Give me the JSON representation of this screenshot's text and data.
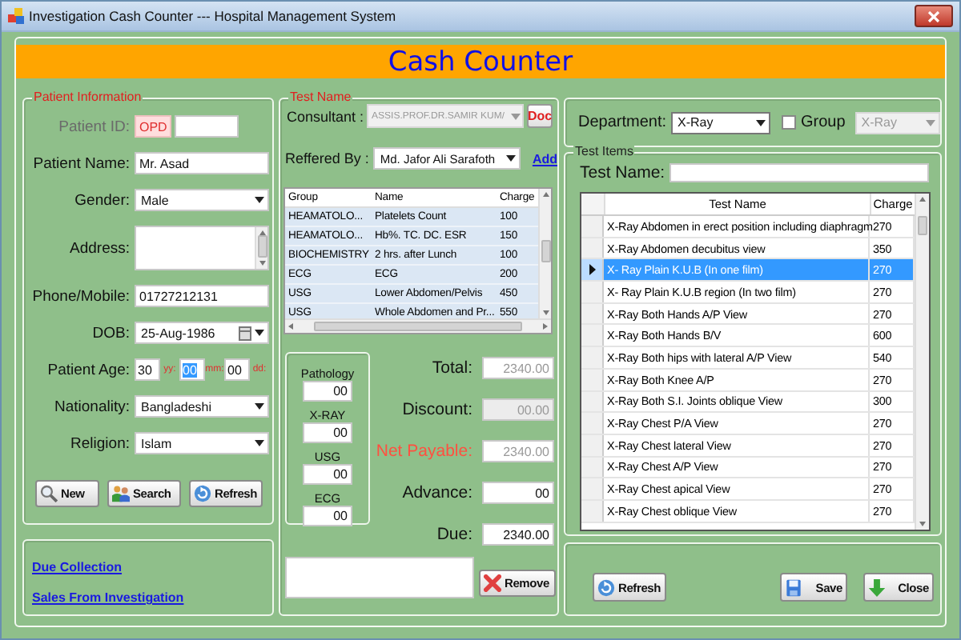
{
  "window": {
    "title": "Investigation Cash Counter --- Hospital Management System"
  },
  "header": {
    "title": "Cash Counter"
  },
  "patient_info": {
    "legend": "Patient Information",
    "fields": [
      {
        "kind": "id",
        "label": "Patient ID:",
        "prefix": "OPD",
        "disabled": true
      },
      {
        "kind": "text",
        "label": "Patient Name:",
        "value": "Mr. Asad",
        "disabled": false
      },
      {
        "kind": "select",
        "label": "Gender:",
        "value": "Male",
        "disabled": false
      },
      {
        "kind": "textarea",
        "label": "Address:",
        "disabled": false
      },
      {
        "kind": "text",
        "label": "Phone/Mobile:",
        "value": "01727212131",
        "disabled": false
      },
      {
        "kind": "date",
        "label": "DOB:",
        "value": "25-Aug-1986",
        "disabled": false
      },
      {
        "kind": "age",
        "label": "Patient Age:",
        "disabled": false,
        "parts": [
          {
            "value": "30",
            "unit": "yy:",
            "selected": false
          },
          {
            "value": "00",
            "unit": "mm:",
            "selected": true
          },
          {
            "value": "00",
            "unit": "dd:",
            "selected": false
          }
        ]
      },
      {
        "kind": "select",
        "label": "Nationality:",
        "value": "Bangladeshi",
        "disabled": false
      },
      {
        "kind": "select",
        "label": "Religion:",
        "value": "Islam",
        "disabled": false
      }
    ],
    "buttons": [
      "New",
      "Search",
      "Refresh"
    ]
  },
  "links": [
    "Due Collection",
    "Sales From Investigation"
  ],
  "test_name": {
    "legend": "Test Name",
    "consultant": {
      "label": "Consultant :",
      "value": "ASSIS.PROF.DR.SAMIR KUM/",
      "disabled": true
    },
    "doc_button": "Doc",
    "referred_by": {
      "label": "Reffered By :",
      "value": "Md. Jafor Ali Sarafoth"
    },
    "add_link": "Add",
    "table": {
      "columns": [
        "Group",
        "Name",
        "Charge"
      ],
      "rows": [
        [
          "HEAMATOLO...",
          "Platelets Count",
          "100"
        ],
        [
          "HEAMATOLO...",
          "Hb%. TC. DC. ESR",
          "150"
        ],
        [
          "BIOCHEMISTRY",
          "2 hrs. after Lunch",
          "100"
        ],
        [
          "ECG",
          "ECG",
          "200"
        ],
        [
          "USG",
          "Lower Abdomen/Pelvis",
          "450"
        ],
        [
          "USG",
          "Whole Abdomen and Pr...",
          "550"
        ]
      ]
    },
    "categories": [
      {
        "label": "Pathology",
        "value": "00"
      },
      {
        "label": "X-RAY",
        "value": "00"
      },
      {
        "label": "USG",
        "value": "00"
      },
      {
        "label": "ECG",
        "value": "00"
      }
    ],
    "totals": [
      {
        "label": "Total:",
        "value": "2340.00",
        "kind": "readonly",
        "emphasized": false
      },
      {
        "label": "Discount:",
        "value": "00.00",
        "kind": "disabled",
        "emphasized": false
      },
      {
        "label": "Net Payable:",
        "value": "2340.00",
        "kind": "readonly",
        "emphasized": true
      },
      {
        "label": "Advance:",
        "value": "00",
        "kind": "input",
        "emphasized": false
      },
      {
        "label": "Due:",
        "value": "2340.00",
        "kind": "input",
        "emphasized": false
      }
    ],
    "remove_button": "Remove"
  },
  "department": {
    "label": "Department:",
    "value": "X-Ray"
  },
  "group_filter": {
    "label": "Group",
    "checked": false,
    "value": "X-Ray",
    "disabled": true
  },
  "test_items": {
    "legend": "Test Items",
    "search_label": "Test Name:",
    "table": {
      "columns": [
        "Test Name",
        "Charge"
      ],
      "rows": [
        {
          "name": "X-Ray Abdomen in erect position including diaphragm",
          "charge": "270",
          "selected": false
        },
        {
          "name": "X-Ray Abdomen decubitus view",
          "charge": "350",
          "selected": false
        },
        {
          "name": "X- Ray Plain K.U.B (In one film)",
          "charge": "270",
          "selected": true
        },
        {
          "name": "X- Ray Plain K.U.B region (In two film)",
          "charge": "270",
          "selected": false
        },
        {
          "name": "X-Ray Both Hands A/P View",
          "charge": "270",
          "selected": false
        },
        {
          "name": "X-Ray Both Hands B/V",
          "charge": "600",
          "selected": false
        },
        {
          "name": "X-Ray Both hips with lateral A/P View",
          "charge": "540",
          "selected": false
        },
        {
          "name": "X-Ray Both Knee A/P",
          "charge": "270",
          "selected": false
        },
        {
          "name": "X-Ray Both S.I. Joints oblique View",
          "charge": "300",
          "selected": false
        },
        {
          "name": "X-Ray Chest P/A View",
          "charge": "270",
          "selected": false
        },
        {
          "name": "X-Ray Chest lateral View",
          "charge": "270",
          "selected": false
        },
        {
          "name": "X-Ray Chest A/P View",
          "charge": "270",
          "selected": false
        },
        {
          "name": "X-Ray Chest apical View",
          "charge": "270",
          "selected": false
        },
        {
          "name": "X-Ray Chest oblique View",
          "charge": "270",
          "selected": false
        }
      ]
    }
  },
  "actions": [
    "Refresh",
    "Save",
    "Close"
  ]
}
